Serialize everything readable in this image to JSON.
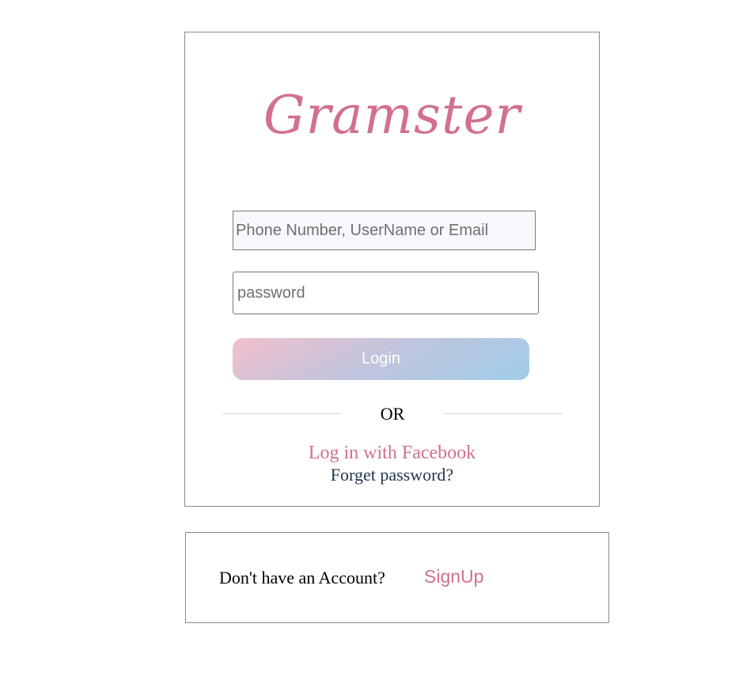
{
  "brand": {
    "name": "Gramster",
    "accent_color": "#d2708f"
  },
  "login_form": {
    "identifier_placeholder": "Phone Number, UserName or Email",
    "identifier_value": "",
    "password_placeholder": "password",
    "password_value": "",
    "login_label": "Login",
    "divider_label": "OR",
    "facebook_label": "Log in with Facebook",
    "forgot_label": "Forget password?"
  },
  "signup": {
    "prompt": "Don't have an Account?",
    "link_label": "SignUp"
  }
}
